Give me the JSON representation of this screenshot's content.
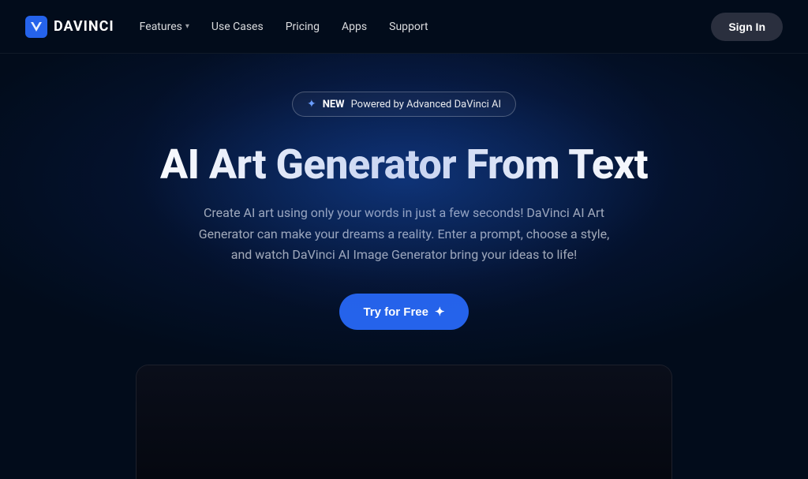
{
  "navbar": {
    "logo_text": "DAVINCI",
    "nav_items": [
      {
        "label": "Features",
        "has_dropdown": true
      },
      {
        "label": "Use Cases",
        "has_dropdown": false
      },
      {
        "label": "Pricing",
        "has_dropdown": false
      },
      {
        "label": "Apps",
        "has_dropdown": false
      },
      {
        "label": "Support",
        "has_dropdown": false
      }
    ],
    "sign_in_label": "Sign In"
  },
  "hero": {
    "badge_sparkle": "✦",
    "badge_new": "NEW",
    "badge_text": "Powered by Advanced DaVinci AI",
    "title": "AI Art Generator From Text",
    "subtitle": "Create AI art using only your words in just a few seconds! DaVinci AI Art Generator can make your dreams a reality. Enter a prompt, choose a style, and watch DaVinci AI Image Generator bring your ideas to life!",
    "cta_label": "Try for Free",
    "cta_sparkle": "✦"
  },
  "colors": {
    "background": "#020c1b",
    "accent_blue": "#2563eb",
    "sign_in_bg": "#2a2f3e"
  }
}
